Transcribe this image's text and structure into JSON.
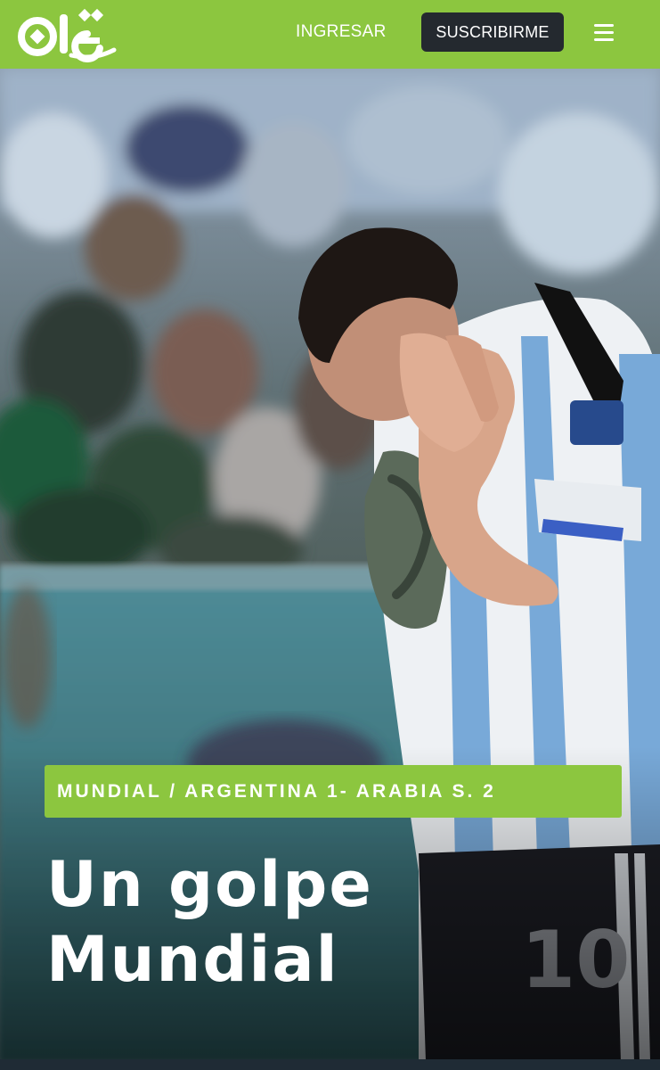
{
  "header": {
    "logo_text": "olé",
    "login_label": "INGRESAR",
    "subscribe_label": "SUSCRIBIRME",
    "menu_icon": "hamburger-menu-icon",
    "brand_color": "#8cc63f",
    "subscribe_bg": "#24292f"
  },
  "hero": {
    "category": "MUNDIAL / ARGENTINA 1- ARABIA S. 2",
    "headline_line1": "Un golpe",
    "headline_line2": "Mundial",
    "shirt_number": "10"
  }
}
